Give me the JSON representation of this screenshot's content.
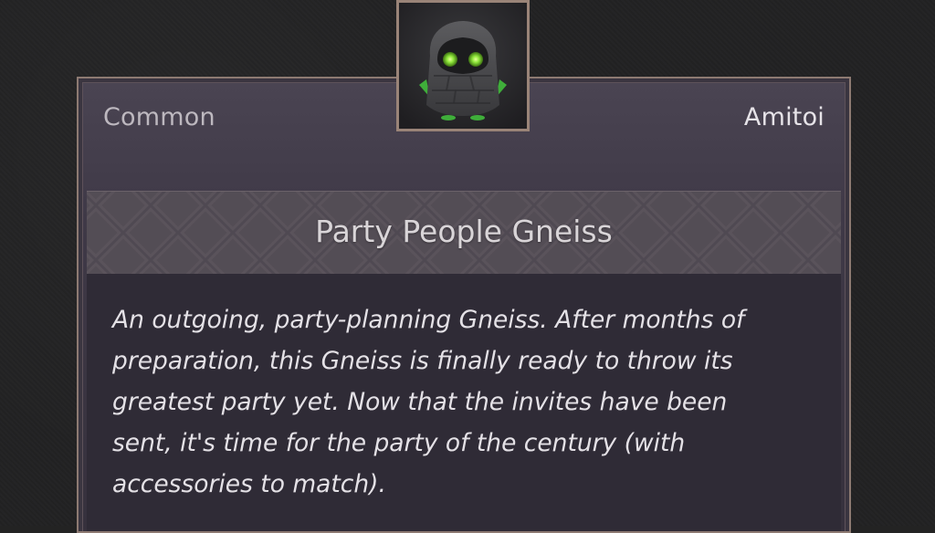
{
  "item_card": {
    "rarity": "Common",
    "category": "Amitoi",
    "name": "Party People Gneiss",
    "description_lines": [
      "An outgoing, party-planning Gneiss. After months of",
      "preparation, this Gneiss is finally ready to throw its",
      "greatest party yet. Now that the invites have been",
      "sent, it's time for the party of the century (with",
      "accessories to match)."
    ],
    "portrait_icon": "gneiss-amitoi-portrait",
    "colors": {
      "frame": "#8d7a72",
      "card_bg": "#3a3540",
      "title_band": "#544d55",
      "body_bg": "#2f2b36",
      "eye_glow": "#8ee63a"
    }
  }
}
